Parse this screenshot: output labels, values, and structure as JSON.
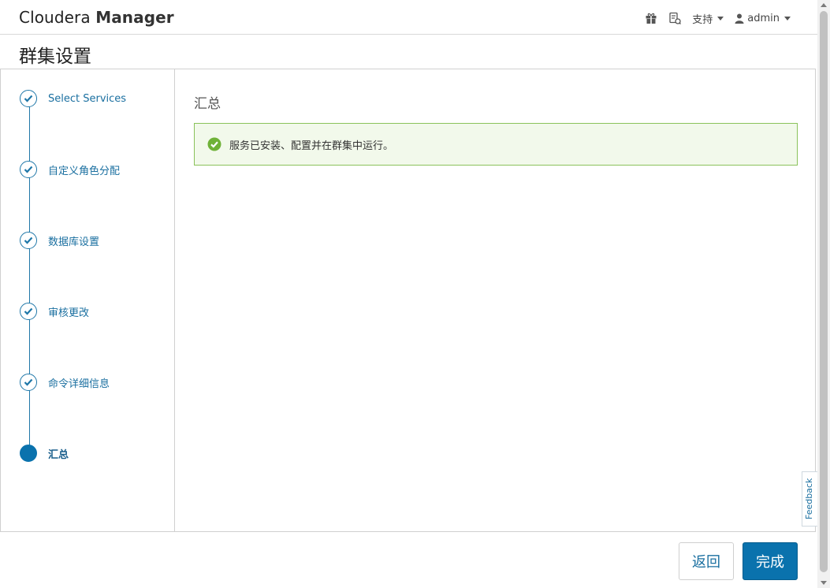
{
  "header": {
    "brand_light": "Cloudera",
    "brand_bold": "Manager",
    "icons": [
      "gift-icon",
      "support-ticket-icon"
    ],
    "support_label": "支持",
    "user_label": "admin"
  },
  "page": {
    "title": "群集设置"
  },
  "steps": [
    {
      "label": "Select Services",
      "state": "done"
    },
    {
      "label": "自定义角色分配",
      "state": "done"
    },
    {
      "label": "数据库设置",
      "state": "done"
    },
    {
      "label": "审核更改",
      "state": "done"
    },
    {
      "label": "命令详细信息",
      "state": "done"
    },
    {
      "label": "汇总",
      "state": "active"
    }
  ],
  "content": {
    "section_title": "汇总",
    "alert_message": "服务已安装、配置并在群集中运行。",
    "alert_icon": "check-circle-icon"
  },
  "feedback_label": "Feedback",
  "footer": {
    "back_label": "返回",
    "finish_label": "完成"
  },
  "colors": {
    "accent": "#0a72ad",
    "success_border": "#8ac25a",
    "success_bg": "#f2f9eb",
    "success_icon": "#6fb238"
  }
}
